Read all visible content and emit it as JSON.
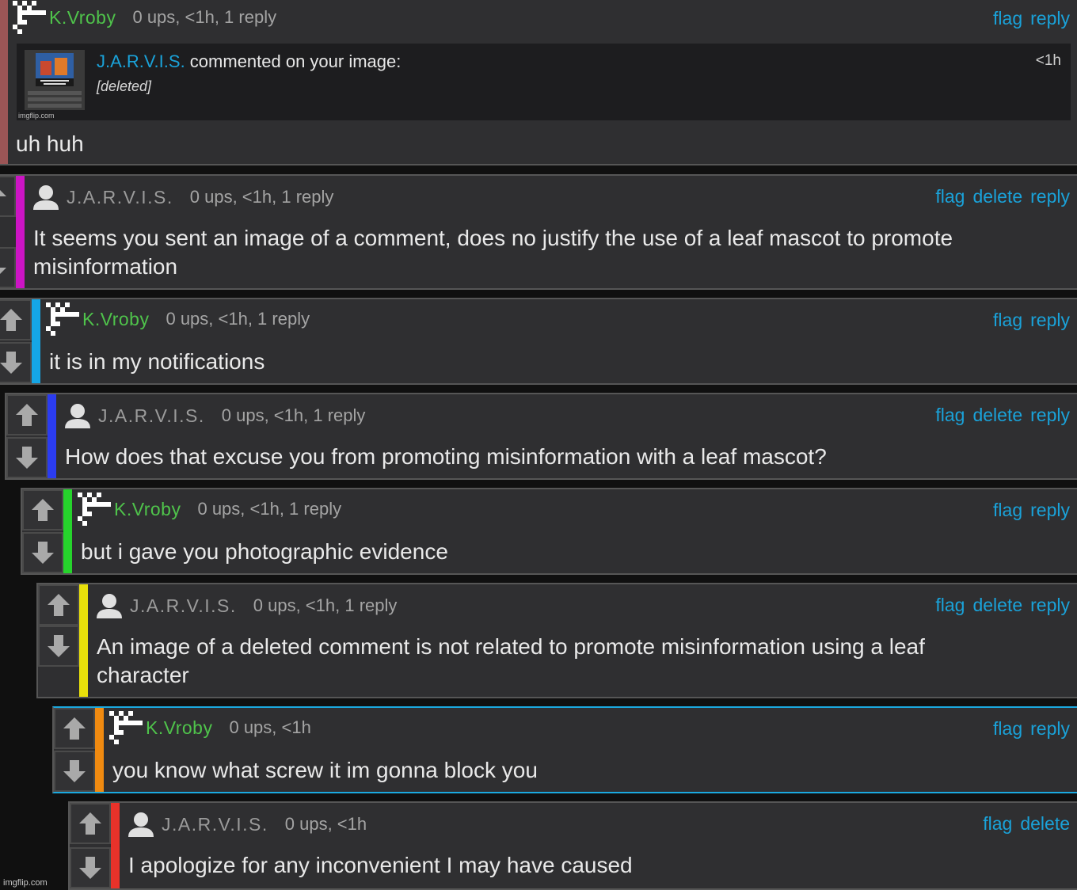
{
  "comments": [
    {
      "user": "K.Vroby",
      "meta": "0 ups, <1h, 1 reply",
      "actions": [
        "flag",
        "reply"
      ],
      "notification": {
        "actor": "J.A.R.V.I.S.",
        "action": " commented on your image:",
        "content": "[deleted]",
        "time": "<1h",
        "source": "imgflip.com"
      },
      "text": "uh huh",
      "bar_color": "#9b5556"
    },
    {
      "user": "J.A.R.V.I.S.",
      "meta": "0 ups, <1h, 1 reply",
      "actions": [
        "flag",
        "delete",
        "reply"
      ],
      "text": "It seems you sent an image of a comment, does no justify the use of a leaf mascot to promote misinformation",
      "bar_color": "#cc14c4"
    },
    {
      "user": "K.Vroby",
      "meta": "0 ups, <1h, 1 reply",
      "actions": [
        "flag",
        "reply"
      ],
      "text": "it is in my notifications",
      "bar_color": "#15a6e6"
    },
    {
      "user": "J.A.R.V.I.S.",
      "meta": "0 ups, <1h, 1 reply",
      "actions": [
        "flag",
        "delete",
        "reply"
      ],
      "text": "How does that excuse you from promoting misinformation with a leaf mascot?",
      "bar_color": "#2b3cf0"
    },
    {
      "user": "K.Vroby",
      "meta": "0 ups, <1h, 1 reply",
      "actions": [
        "flag",
        "reply"
      ],
      "text": "but i gave you photographic evidence",
      "bar_color": "#26d42c"
    },
    {
      "user": "J.A.R.V.I.S.",
      "meta": "0 ups, <1h, 1 reply",
      "actions": [
        "flag",
        "delete",
        "reply"
      ],
      "text": "An image of a deleted comment is not related to promote misinformation using a leaf character",
      "bar_color": "#e8e00b"
    },
    {
      "user": "K.Vroby",
      "meta": "0 ups, <1h",
      "actions": [
        "flag",
        "reply"
      ],
      "text": "you know what screw it im gonna block you",
      "bar_color": "#f08a10"
    },
    {
      "user": "J.A.R.V.I.S.",
      "meta": "0 ups, <1h",
      "actions": [
        "flag",
        "delete"
      ],
      "text": "I apologize for any inconvenient I may have caused",
      "bar_color": "#e8322a"
    }
  ],
  "watermark": "imgflip.com"
}
